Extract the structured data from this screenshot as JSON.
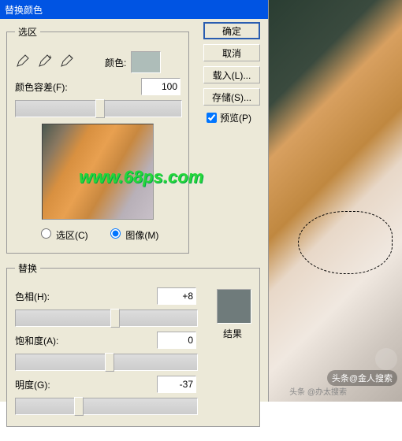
{
  "title": "替换颜色",
  "selection_group": {
    "legend": "选区",
    "color_label": "颜色:",
    "swatch_color": "#aebdb9",
    "fuzziness_label": "颜色容差(F):",
    "fuzziness_value": "100",
    "radio_selection": "选区(C)",
    "radio_image": "图像(M)"
  },
  "replace_group": {
    "legend": "替换",
    "hue_label": "色相(H):",
    "hue_value": "+8",
    "sat_label": "饱和度(A):",
    "sat_value": "0",
    "light_label": "明度(G):",
    "light_value": "-37",
    "result_label": "结果",
    "result_color": "#6f7b7b"
  },
  "buttons": {
    "ok": "确定",
    "cancel": "取消",
    "load": "载入(L)...",
    "save": "存储(S)...",
    "preview": "预览(P)"
  },
  "watermark": "www.68ps.com",
  "wm2": "头条@金人搜索",
  "wm3": "头条 @办太搜索"
}
